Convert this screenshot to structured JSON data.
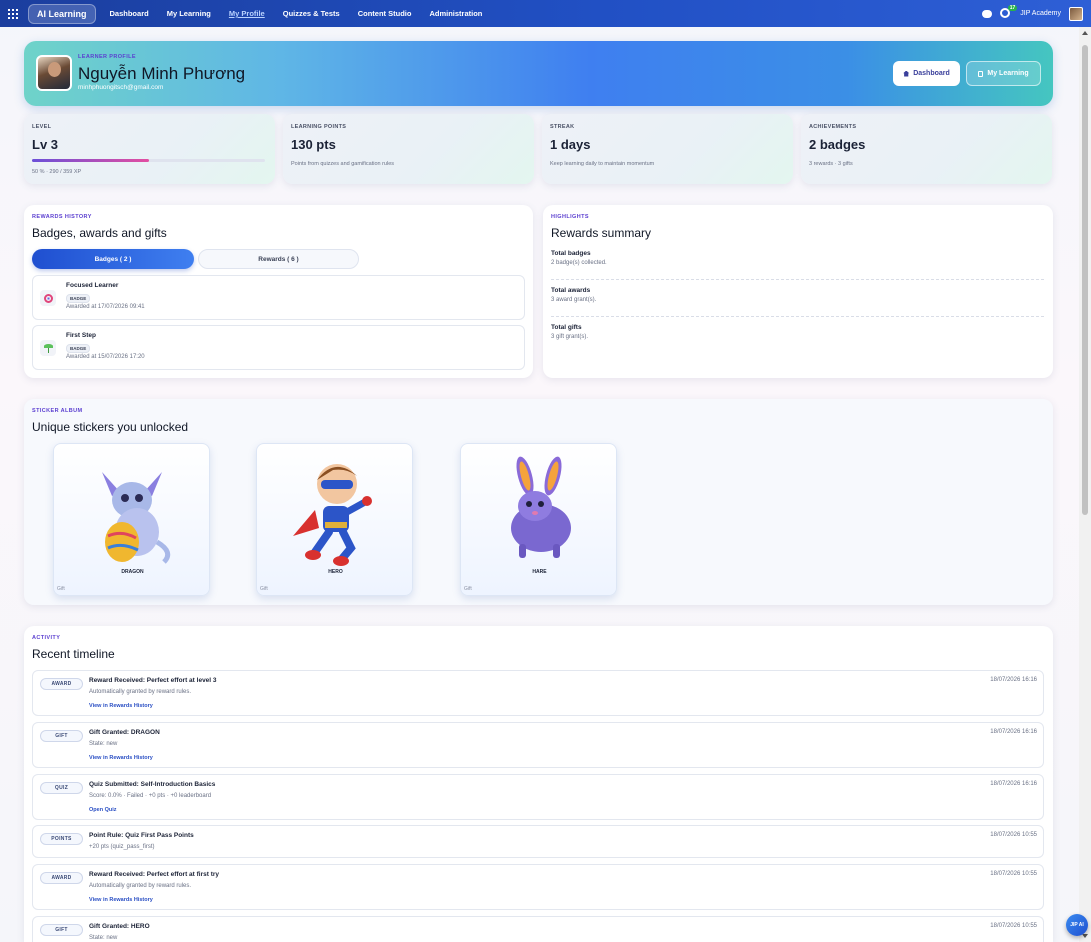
{
  "nav": {
    "brand": "AI Learning",
    "links": [
      "Dashboard",
      "My Learning",
      "My Profile",
      "Quizzes & Tests",
      "Content Studio",
      "Administration"
    ],
    "notification_count": "17",
    "org_name": "JIP Academy"
  },
  "profile": {
    "kicker": "LEARNER PROFILE",
    "name": "Nguyễn Minh Phương",
    "email": "minhphuongitsch@gmail.com",
    "dashboard_btn": "Dashboard",
    "mylearning_btn": "My Learning"
  },
  "stats": {
    "level": {
      "kicker": "LEVEL",
      "value": "Lv 3",
      "progress_percent": 50,
      "sub": "50 % · 290 / 359 XP"
    },
    "points": {
      "kicker": "LEARNING POINTS",
      "value": "130 pts",
      "sub": "Points from quizzes and gamification rules"
    },
    "streak": {
      "kicker": "STREAK",
      "value": "1 days",
      "sub": "Keep learning daily to maintain momentum"
    },
    "achievements": {
      "kicker": "ACHIEVEMENTS",
      "value": "2 badges",
      "sub": "3 rewards · 3 gifts"
    }
  },
  "rewards_history": {
    "kicker": "REWARDS HISTORY",
    "title": "Badges, awards and gifts",
    "tab_badges": "Badges ( 2 )",
    "tab_rewards": "Rewards ( 6 )",
    "badges": [
      {
        "name": "Focused Learner",
        "tag": "BADGE",
        "date": "Awarded at 17/07/2026 09:41",
        "icon": "target-icon"
      },
      {
        "name": "First Step",
        "tag": "BADGE",
        "date": "Awarded at 15/07/2026 17:20",
        "icon": "sprout-icon"
      }
    ]
  },
  "highlights": {
    "kicker": "HIGHLIGHTS",
    "title": "Rewards summary",
    "rows": [
      {
        "label": "Total badges",
        "value": "2 badge(s) collected."
      },
      {
        "label": "Total awards",
        "value": "3 award grant(s)."
      },
      {
        "label": "Total gifts",
        "value": "3 gift grant(s)."
      }
    ]
  },
  "sticker_album": {
    "kicker": "STICKER ALBUM",
    "title": "Unique stickers you unlocked",
    "stickers": [
      {
        "name": "DRAGON",
        "type": "Gift"
      },
      {
        "name": "HERO",
        "type": "Gift"
      },
      {
        "name": "HARE",
        "type": "Gift"
      }
    ]
  },
  "activity": {
    "kicker": "ACTIVITY",
    "title": "Recent timeline",
    "items": [
      {
        "chip": "AWARD",
        "title": "Reward Received: Perfect effort at level 3",
        "desc": "Automatically granted by reward rules.",
        "link": "View in Rewards History",
        "time": "18/07/2026 16:16"
      },
      {
        "chip": "GIFT",
        "title": "Gift Granted: DRAGON",
        "desc": "State: new",
        "link": "View in Rewards History",
        "time": "18/07/2026 16:16"
      },
      {
        "chip": "QUIZ",
        "title": "Quiz Submitted: Self-Introduction Basics",
        "desc": "Score: 0.0% · Failed · +0 pts · +0 leaderboard",
        "link": "Open Quiz",
        "time": "18/07/2026 16:16"
      },
      {
        "chip": "POINTS",
        "title": "Point Rule: Quiz First Pass Points",
        "desc": "+20 pts (quiz_pass_first)",
        "link": "",
        "time": "18/07/2026 10:55"
      },
      {
        "chip": "AWARD",
        "title": "Reward Received: Perfect effort at first try",
        "desc": "Automatically granted by reward rules.",
        "link": "View in Rewards History",
        "time": "18/07/2026 10:55"
      },
      {
        "chip": "GIFT",
        "title": "Gift Granted: HERO",
        "desc": "State: new",
        "link": "",
        "time": "18/07/2026 10:55"
      }
    ]
  },
  "fab": {
    "label": "JIP AI"
  }
}
